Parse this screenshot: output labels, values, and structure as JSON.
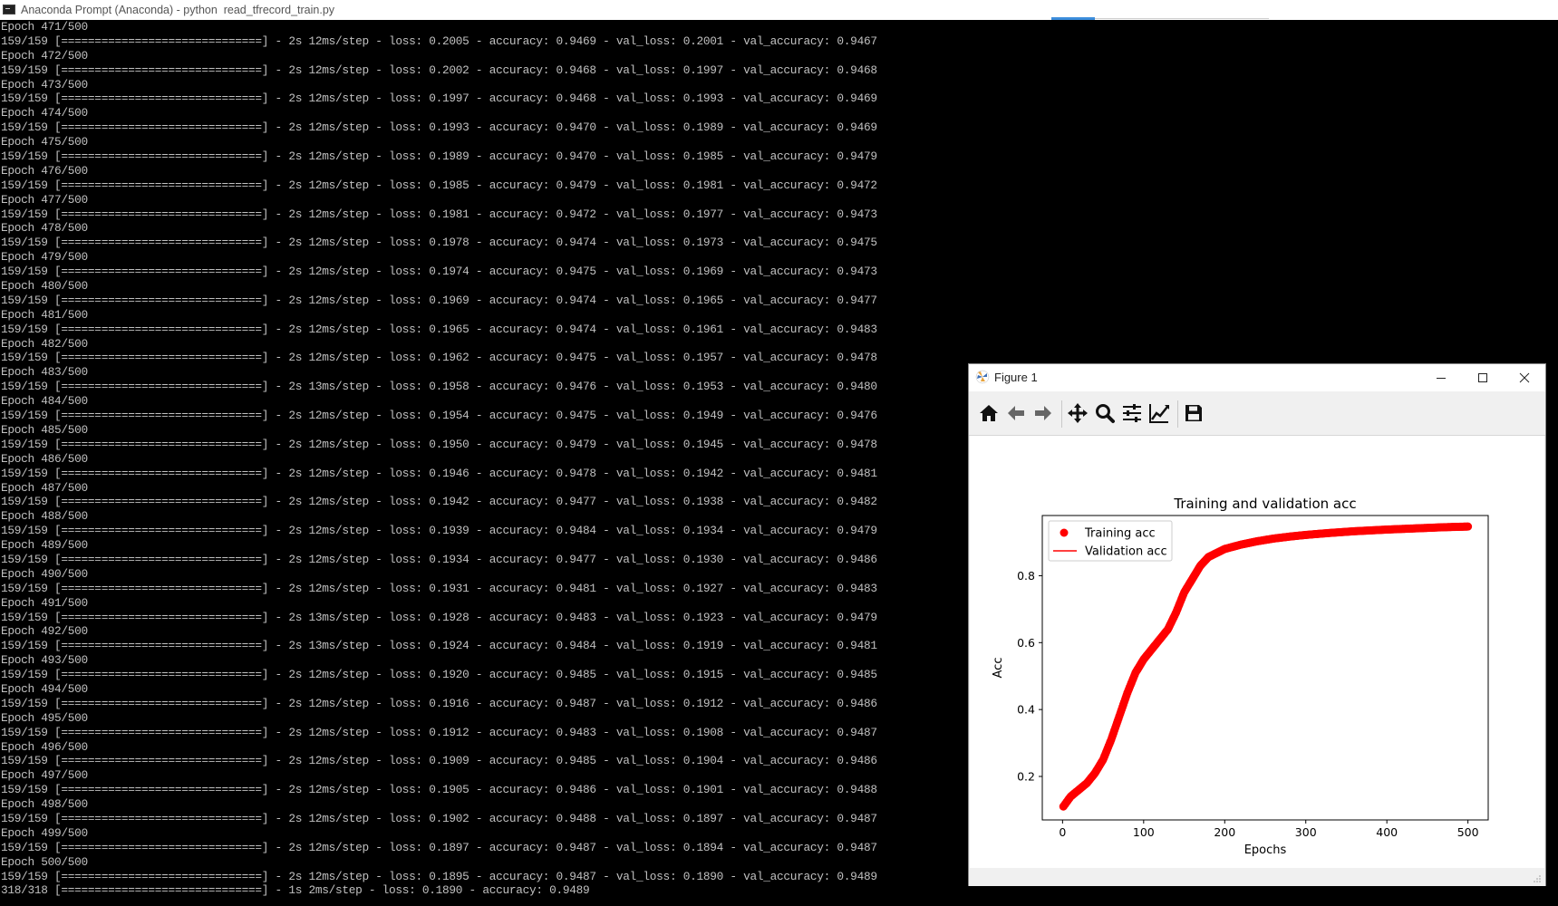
{
  "console": {
    "title": "Anaconda Prompt (Anaconda) - python  read_tfrecord_train.py",
    "lines": [
      "Epoch 471/500",
      "159/159 [==============================] - 2s 12ms/step - loss: 0.2005 - accuracy: 0.9469 - val_loss: 0.2001 - val_accuracy: 0.9467",
      "Epoch 472/500",
      "159/159 [==============================] - 2s 12ms/step - loss: 0.2002 - accuracy: 0.9468 - val_loss: 0.1997 - val_accuracy: 0.9468",
      "Epoch 473/500",
      "159/159 [==============================] - 2s 12ms/step - loss: 0.1997 - accuracy: 0.9468 - val_loss: 0.1993 - val_accuracy: 0.9469",
      "Epoch 474/500",
      "159/159 [==============================] - 2s 12ms/step - loss: 0.1993 - accuracy: 0.9470 - val_loss: 0.1989 - val_accuracy: 0.9469",
      "Epoch 475/500",
      "159/159 [==============================] - 2s 12ms/step - loss: 0.1989 - accuracy: 0.9470 - val_loss: 0.1985 - val_accuracy: 0.9479",
      "Epoch 476/500",
      "159/159 [==============================] - 2s 12ms/step - loss: 0.1985 - accuracy: 0.9479 - val_loss: 0.1981 - val_accuracy: 0.9472",
      "Epoch 477/500",
      "159/159 [==============================] - 2s 12ms/step - loss: 0.1981 - accuracy: 0.9472 - val_loss: 0.1977 - val_accuracy: 0.9473",
      "Epoch 478/500",
      "159/159 [==============================] - 2s 12ms/step - loss: 0.1978 - accuracy: 0.9474 - val_loss: 0.1973 - val_accuracy: 0.9475",
      "Epoch 479/500",
      "159/159 [==============================] - 2s 12ms/step - loss: 0.1974 - accuracy: 0.9475 - val_loss: 0.1969 - val_accuracy: 0.9473",
      "Epoch 480/500",
      "159/159 [==============================] - 2s 12ms/step - loss: 0.1969 - accuracy: 0.9474 - val_loss: 0.1965 - val_accuracy: 0.9477",
      "Epoch 481/500",
      "159/159 [==============================] - 2s 12ms/step - loss: 0.1965 - accuracy: 0.9474 - val_loss: 0.1961 - val_accuracy: 0.9483",
      "Epoch 482/500",
      "159/159 [==============================] - 2s 12ms/step - loss: 0.1962 - accuracy: 0.9475 - val_loss: 0.1957 - val_accuracy: 0.9478",
      "Epoch 483/500",
      "159/159 [==============================] - 2s 13ms/step - loss: 0.1958 - accuracy: 0.9476 - val_loss: 0.1953 - val_accuracy: 0.9480",
      "Epoch 484/500",
      "159/159 [==============================] - 2s 12ms/step - loss: 0.1954 - accuracy: 0.9475 - val_loss: 0.1949 - val_accuracy: 0.9476",
      "Epoch 485/500",
      "159/159 [==============================] - 2s 12ms/step - loss: 0.1950 - accuracy: 0.9479 - val_loss: 0.1945 - val_accuracy: 0.9478",
      "Epoch 486/500",
      "159/159 [==============================] - 2s 12ms/step - loss: 0.1946 - accuracy: 0.9478 - val_loss: 0.1942 - val_accuracy: 0.9481",
      "Epoch 487/500",
      "159/159 [==============================] - 2s 12ms/step - loss: 0.1942 - accuracy: 0.9477 - val_loss: 0.1938 - val_accuracy: 0.9482",
      "Epoch 488/500",
      "159/159 [==============================] - 2s 12ms/step - loss: 0.1939 - accuracy: 0.9484 - val_loss: 0.1934 - val_accuracy: 0.9479",
      "Epoch 489/500",
      "159/159 [==============================] - 2s 12ms/step - loss: 0.1934 - accuracy: 0.9477 - val_loss: 0.1930 - val_accuracy: 0.9486",
      "Epoch 490/500",
      "159/159 [==============================] - 2s 12ms/step - loss: 0.1931 - accuracy: 0.9481 - val_loss: 0.1927 - val_accuracy: 0.9483",
      "Epoch 491/500",
      "159/159 [==============================] - 2s 13ms/step - loss: 0.1928 - accuracy: 0.9483 - val_loss: 0.1923 - val_accuracy: 0.9479",
      "Epoch 492/500",
      "159/159 [==============================] - 2s 13ms/step - loss: 0.1924 - accuracy: 0.9484 - val_loss: 0.1919 - val_accuracy: 0.9481",
      "Epoch 493/500",
      "159/159 [==============================] - 2s 12ms/step - loss: 0.1920 - accuracy: 0.9485 - val_loss: 0.1915 - val_accuracy: 0.9485",
      "Epoch 494/500",
      "159/159 [==============================] - 2s 12ms/step - loss: 0.1916 - accuracy: 0.9487 - val_loss: 0.1912 - val_accuracy: 0.9486",
      "Epoch 495/500",
      "159/159 [==============================] - 2s 12ms/step - loss: 0.1912 - accuracy: 0.9483 - val_loss: 0.1908 - val_accuracy: 0.9487",
      "Epoch 496/500",
      "159/159 [==============================] - 2s 12ms/step - loss: 0.1909 - accuracy: 0.9485 - val_loss: 0.1904 - val_accuracy: 0.9486",
      "Epoch 497/500",
      "159/159 [==============================] - 2s 12ms/step - loss: 0.1905 - accuracy: 0.9486 - val_loss: 0.1901 - val_accuracy: 0.9488",
      "Epoch 498/500",
      "159/159 [==============================] - 2s 12ms/step - loss: 0.1902 - accuracy: 0.9488 - val_loss: 0.1897 - val_accuracy: 0.9487",
      "Epoch 499/500",
      "159/159 [==============================] - 2s 12ms/step - loss: 0.1897 - accuracy: 0.9487 - val_loss: 0.1894 - val_accuracy: 0.9487",
      "Epoch 500/500",
      "159/159 [==============================] - 2s 12ms/step - loss: 0.1895 - accuracy: 0.9487 - val_loss: 0.1890 - val_accuracy: 0.9489",
      "318/318 [==============================] - 1s 2ms/step - loss: 0.1890 - accuracy: 0.9489"
    ]
  },
  "figure": {
    "title": "Figure 1",
    "toolbar": [
      {
        "name": "home-icon",
        "label": "Home"
      },
      {
        "name": "back-icon",
        "label": "Back"
      },
      {
        "name": "forward-icon",
        "label": "Forward"
      },
      {
        "name": "pan-icon",
        "label": "Pan"
      },
      {
        "name": "zoom-icon",
        "label": "Zoom"
      },
      {
        "name": "subplots-icon",
        "label": "Configure subplots"
      },
      {
        "name": "edit-axis-icon",
        "label": "Edit axis"
      },
      {
        "name": "save-icon",
        "label": "Save"
      }
    ],
    "colors": {
      "series": "#ff0000",
      "window_bg": "#f0f0f0",
      "console_text": "#c0c0c0"
    }
  },
  "chart_data": {
    "type": "scatter",
    "title": "Training and validation acc",
    "xlabel": "Epochs",
    "ylabel": "Acc",
    "xlim": [
      -25,
      525
    ],
    "ylim": [
      0.07,
      0.98
    ],
    "xticks": [
      0,
      100,
      200,
      300,
      400,
      500
    ],
    "xtick_labels": [
      "0",
      "100",
      "200",
      "300",
      "400",
      "500"
    ],
    "yticks": [
      0.2,
      0.4,
      0.6,
      0.8
    ],
    "ytick_labels": [
      "0.2",
      "0.4",
      "0.6",
      "0.8"
    ],
    "grid": false,
    "legend": "upper-left",
    "series": [
      {
        "name": "Training acc",
        "style": "markers",
        "color": "#ff0000",
        "x": [
          1,
          10,
          20,
          30,
          40,
          50,
          60,
          70,
          80,
          90,
          100,
          110,
          120,
          130,
          140,
          150,
          160,
          170,
          180,
          190,
          200,
          220,
          240,
          260,
          280,
          300,
          330,
          360,
          400,
          440,
          470,
          500
        ],
        "y": [
          0.11,
          0.14,
          0.16,
          0.18,
          0.21,
          0.25,
          0.31,
          0.38,
          0.45,
          0.51,
          0.55,
          0.58,
          0.61,
          0.64,
          0.69,
          0.75,
          0.79,
          0.83,
          0.856,
          0.868,
          0.88,
          0.893,
          0.903,
          0.911,
          0.917,
          0.922,
          0.928,
          0.933,
          0.938,
          0.942,
          0.945,
          0.947
        ]
      },
      {
        "name": "Validation acc",
        "style": "line",
        "color": "#ff0000",
        "x": [
          1,
          10,
          20,
          30,
          40,
          50,
          60,
          70,
          80,
          90,
          100,
          110,
          120,
          130,
          140,
          150,
          160,
          170,
          180,
          190,
          200,
          220,
          240,
          260,
          280,
          300,
          330,
          360,
          400,
          440,
          470,
          500
        ],
        "y": [
          0.12,
          0.145,
          0.165,
          0.185,
          0.215,
          0.255,
          0.315,
          0.385,
          0.455,
          0.515,
          0.555,
          0.585,
          0.615,
          0.645,
          0.695,
          0.755,
          0.795,
          0.835,
          0.858,
          0.87,
          0.882,
          0.895,
          0.905,
          0.912,
          0.918,
          0.923,
          0.929,
          0.934,
          0.939,
          0.943,
          0.946,
          0.949
        ]
      }
    ]
  }
}
